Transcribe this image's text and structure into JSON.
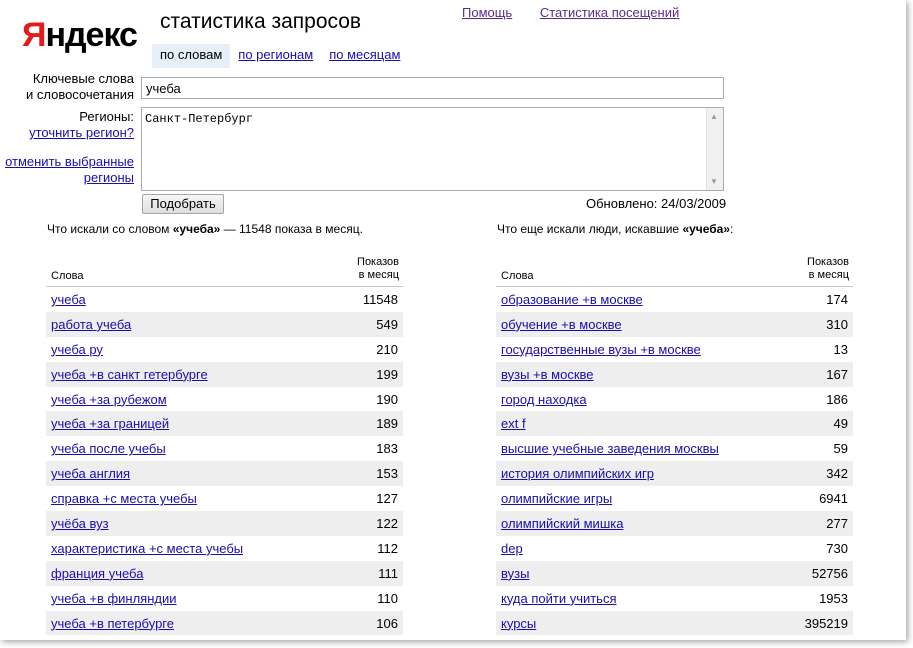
{
  "logo": {
    "first": "Я",
    "rest": "ндекс"
  },
  "title": "статистика запросов",
  "top_links": [
    "Помощь",
    "Статистика посещений"
  ],
  "tabs": [
    {
      "label": "по словам",
      "active": true
    },
    {
      "label": "по регионам",
      "active": false
    },
    {
      "label": "по месяцам",
      "active": false
    }
  ],
  "form": {
    "keywords_label_line1": "Ключевые слова",
    "keywords_label_line2": "и словосочетания",
    "keywords_value": "учеба",
    "regions_label": "Регионы:",
    "refine_region_link": "уточнить регион?",
    "clear_regions_line1": "отменить выбранные",
    "clear_regions_line2": "регионы",
    "regions_value": "Санкт-Петербург",
    "submit_label": "Подобрать",
    "updated": "Обновлено: 24/03/2009"
  },
  "left": {
    "caption_prefix": "Что искали со словом ",
    "caption_word": "«учеба»",
    "caption_suffix": " — 11548 показа в месяц.",
    "col_words": "Слова",
    "col_shows_line1": "Показов",
    "col_shows_line2": "в месяц",
    "rows": [
      {
        "word": "учеба",
        "count": "11548"
      },
      {
        "word": "работа учеба",
        "count": "549"
      },
      {
        "word": "учеба ру",
        "count": "210"
      },
      {
        "word": "учеба +в санкт гетербурге",
        "count": "199"
      },
      {
        "word": "учеба +за рубежом",
        "count": "190"
      },
      {
        "word": "учеба +за границей",
        "count": "189"
      },
      {
        "word": "учеба после учебы",
        "count": "183"
      },
      {
        "word": "учеба англия",
        "count": "153"
      },
      {
        "word": "справка +с места учебы",
        "count": "127"
      },
      {
        "word": "учёба вуз",
        "count": "122"
      },
      {
        "word": "характеристика +с места учебы",
        "count": "112"
      },
      {
        "word": "франция учеба",
        "count": "111"
      },
      {
        "word": "учеба +в финляндии",
        "count": "110"
      },
      {
        "word": "учеба +в петербурге",
        "count": "106"
      }
    ]
  },
  "right": {
    "caption_prefix": "Что еще искали люди, искавшие ",
    "caption_word": "«учеба»",
    "caption_suffix": ":",
    "col_words": "Слова",
    "col_shows_line1": "Показов",
    "col_shows_line2": "в месяц",
    "rows": [
      {
        "word": "образование +в москве",
        "count": "174"
      },
      {
        "word": "обучение +в москве",
        "count": "310"
      },
      {
        "word": "государственные вузы +в москве",
        "count": "13"
      },
      {
        "word": "вузы +в москве",
        "count": "167"
      },
      {
        "word": "город находка",
        "count": "186"
      },
      {
        "word": "ext f",
        "count": "49"
      },
      {
        "word": "высшие учебные заведения москвы",
        "count": "59"
      },
      {
        "word": "история олимпийских игр",
        "count": "342"
      },
      {
        "word": "олимпийские игры",
        "count": "6941"
      },
      {
        "word": "олимпийский мишка",
        "count": "277"
      },
      {
        "word": "dep",
        "count": "730"
      },
      {
        "word": "вузы",
        "count": "52756"
      },
      {
        "word": "куда пойти учиться",
        "count": "1953"
      },
      {
        "word": "курсы",
        "count": "395219"
      }
    ]
  }
}
